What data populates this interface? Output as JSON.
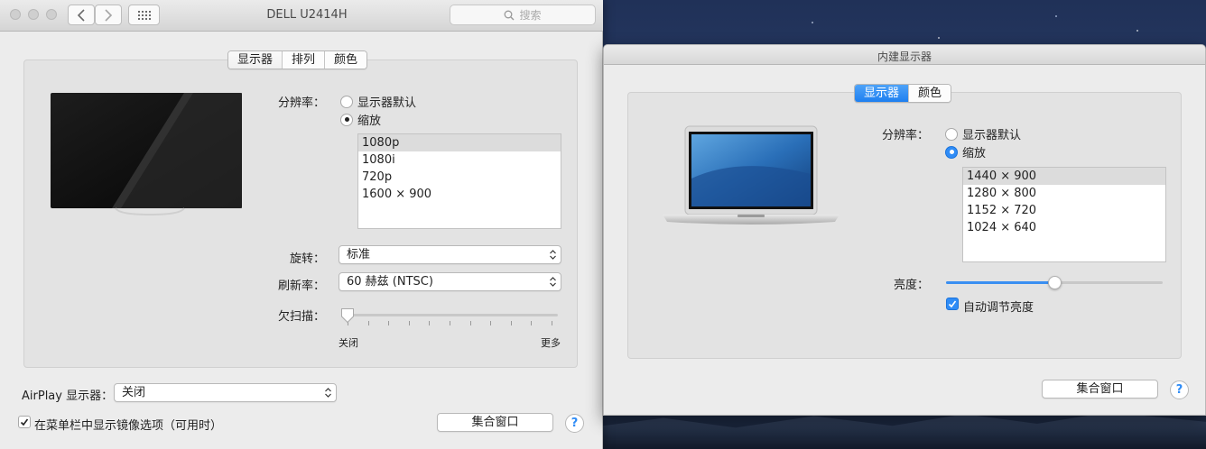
{
  "window1": {
    "title": "DELL U2414H",
    "search_placeholder": "搜索",
    "tabs": [
      "显示器",
      "排列",
      "颜色"
    ],
    "resolution_label": "分辨率：",
    "resolution_options": [
      "显示器默认",
      "缩放"
    ],
    "resolution_list": [
      "1080p",
      "1080i",
      "720p",
      "1600 × 900"
    ],
    "rotation_label": "旋转：",
    "rotation_value": "标准",
    "refresh_label": "刷新率：",
    "refresh_value": "60 赫兹 (NTSC)",
    "underscan_label": "欠扫描：",
    "underscan_min": "关闭",
    "underscan_max": "更多",
    "underscan_level": 0,
    "airplay_label": "AirPlay 显示器：",
    "airplay_value": "关闭",
    "mirror_checkbox_label": "在菜单栏中显示镜像选项（可用时）",
    "gather_button": "集合窗口",
    "help": "?"
  },
  "window2": {
    "title": "内建显示器",
    "tabs": [
      "显示器",
      "颜色"
    ],
    "resolution_label": "分辨率：",
    "resolution_options": [
      "显示器默认",
      "缩放"
    ],
    "resolution_list": [
      "1440 × 900",
      "1280 × 800",
      "1152 × 720",
      "1024 × 640"
    ],
    "brightness_label": "亮度：",
    "brightness_level": 0.5,
    "auto_brightness_label": "自动调节亮度",
    "gather_button": "集合窗口",
    "help": "?"
  },
  "colors": {
    "accent": "#2f8cf6",
    "window_bg": "#ececec"
  }
}
